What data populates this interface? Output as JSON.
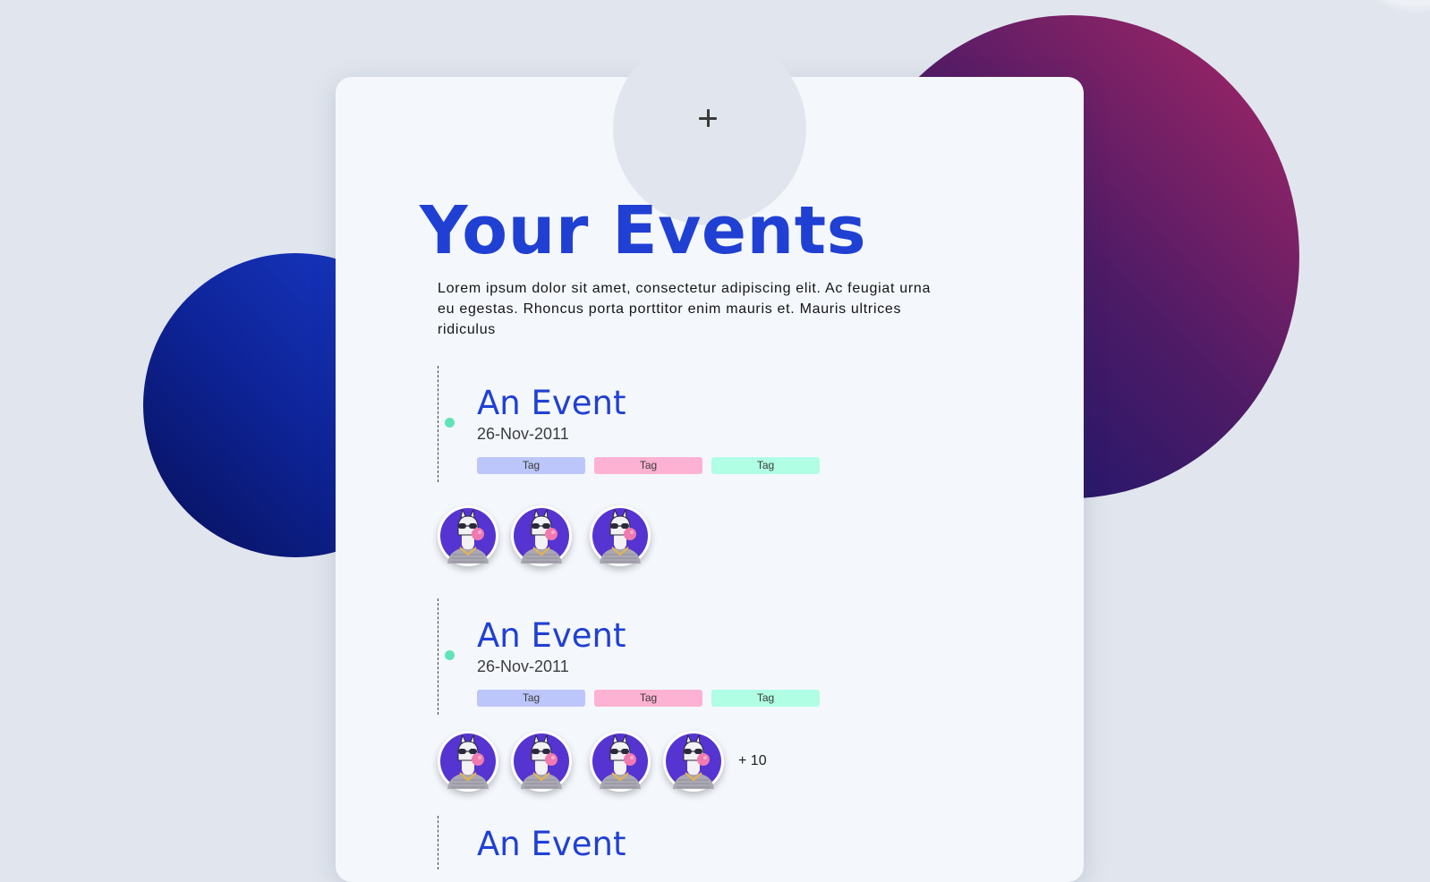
{
  "page": {
    "title": "Your Events",
    "description": "Lorem ipsum dolor sit amet, consectetur adipiscing elit. Ac feugiat urna eu egestas. Rhoncus porta porttitor enim mauris et. Mauris ultrices ridiculus",
    "add_icon": "plus-icon"
  },
  "colors": {
    "accent": "#2040d4",
    "timeline_dot": "#61e3b8",
    "tag_blue": "#bcc6fb",
    "tag_pink": "#feb2d3",
    "tag_green": "#b0fee3",
    "avatar_bg": "#5534d1"
  },
  "events": [
    {
      "title": "An Event",
      "date": "26-Nov-2011",
      "tags": [
        "Tag",
        "Tag",
        "Tag"
      ],
      "attendee_count": 3,
      "more_label": ""
    },
    {
      "title": "An Event",
      "date": "26-Nov-2011",
      "tags": [
        "Tag",
        "Tag",
        "Tag"
      ],
      "attendee_count": 4,
      "more_label": "+ 10"
    },
    {
      "title": "An Event"
    }
  ]
}
